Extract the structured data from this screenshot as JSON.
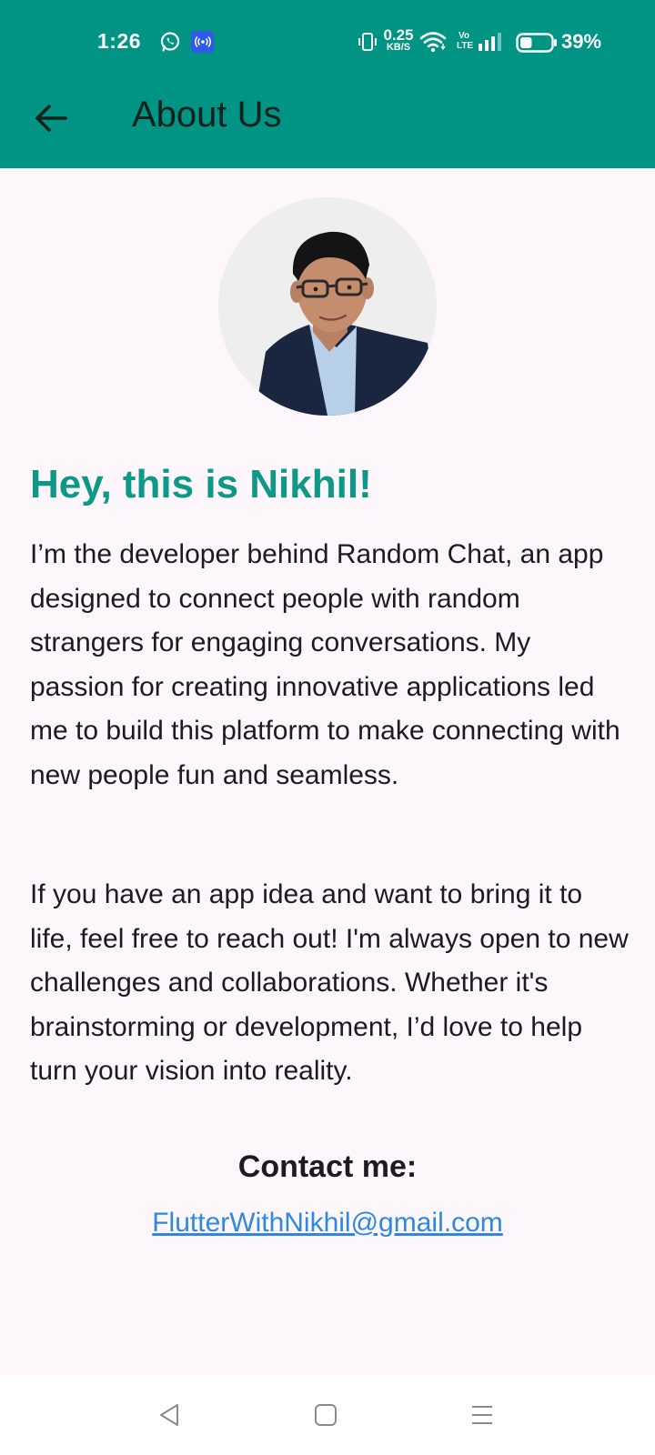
{
  "status_bar": {
    "time": "1:26",
    "speed_value": "0.25",
    "speed_unit": "KB/S",
    "volte_line1": "Vo",
    "volte_line2": "LTE",
    "battery_percent": "39%",
    "battery_level": 0.39,
    "icons": [
      "whatsapp-icon",
      "hotspot-icon",
      "vibrate-icon",
      "wifi-icon",
      "volte-icon",
      "signal-icon",
      "battery-icon"
    ]
  },
  "app_bar": {
    "back_icon": "arrow-left-icon",
    "title": "About Us",
    "color": "#009485"
  },
  "profile": {
    "greeting": "Hey, this is Nikhil!",
    "paragraphs": [
      "I’m the developer behind Random Chat, an app designed to connect people with random strangers for engaging conversations. My passion for creating innovative applications led me to build this platform to make connecting with new people fun and seamless.",
      "If you have an app idea and want to bring it to life, feel free to reach out! I'm always open to new challenges and collaborations. Whether it's brainstorming or development, I’d love to help turn your vision into reality."
    ],
    "accent_color": "#0E9888"
  },
  "contact": {
    "label": "Contact me:",
    "email": "FlutterWithNikhil@gmail.com",
    "link_color": "#2F88E0"
  },
  "nav_bar": {
    "icons": [
      "nav-back-icon",
      "nav-home-icon",
      "nav-recents-icon"
    ]
  }
}
